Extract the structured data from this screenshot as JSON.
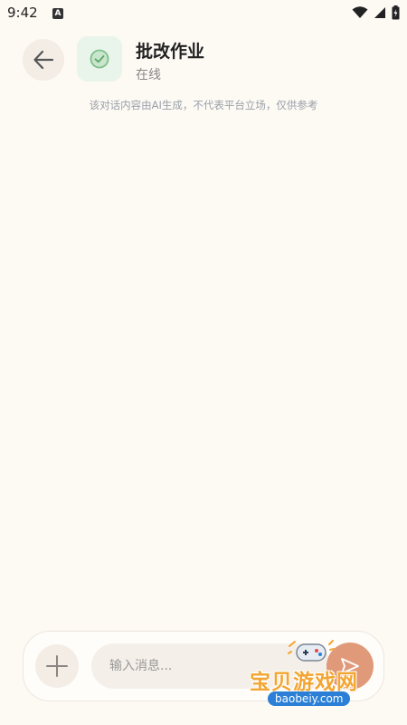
{
  "status_bar": {
    "time": "9:42",
    "notification_letter": "A"
  },
  "header": {
    "bot_name": "批改作业",
    "bot_status": "在线",
    "disclaimer": "该对话内容由AI生成，不代表平台立场，仅供参考"
  },
  "composer": {
    "placeholder": "输入消息..."
  },
  "watermark": {
    "text": "宝贝游戏网",
    "url": "baobeiy.com"
  },
  "colors": {
    "background": "#fdf9f3",
    "send_button": "#e09a7a",
    "avatar_bg": "#e9f4ea",
    "avatar_check": "#7fbf8a",
    "watermark_orange": "#f3a531",
    "watermark_blue": "#2b7fd6"
  },
  "icons": {
    "back": "arrow-left-icon",
    "avatar": "check-circle-icon",
    "add": "plus-icon",
    "send": "paper-plane-icon",
    "wifi": "wifi-icon",
    "signal": "signal-icon",
    "battery": "battery-icon"
  }
}
